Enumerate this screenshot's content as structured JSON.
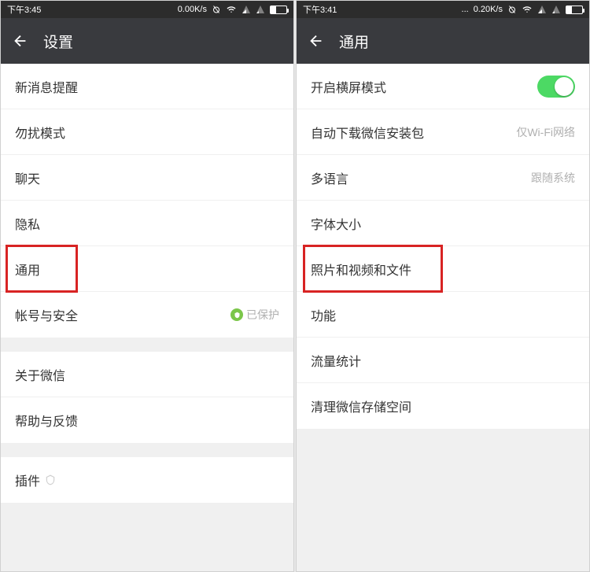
{
  "left": {
    "statusbar": {
      "time": "下午3:45",
      "speed": "0.00K/s"
    },
    "title": "设置",
    "rows": {
      "new_msg": "新消息提醒",
      "dnd": "勿扰模式",
      "chat": "聊天",
      "privacy": "隐私",
      "general": "通用",
      "account": "帐号与安全",
      "account_status": "已保护",
      "about": "关于微信",
      "help": "帮助与反馈",
      "plugins": "插件"
    }
  },
  "right": {
    "statusbar": {
      "time": "下午3:41",
      "speed": "0.20K/s"
    },
    "title": "通用",
    "rows": {
      "landscape": "开启横屏模式",
      "autodl": "自动下载微信安装包",
      "autodl_val": "仅Wi-Fi网络",
      "lang": "多语言",
      "lang_val": "跟随系统",
      "font": "字体大小",
      "media": "照片和视频和文件",
      "features": "功能",
      "traffic": "流量统计",
      "storage": "清理微信存储空间"
    }
  }
}
